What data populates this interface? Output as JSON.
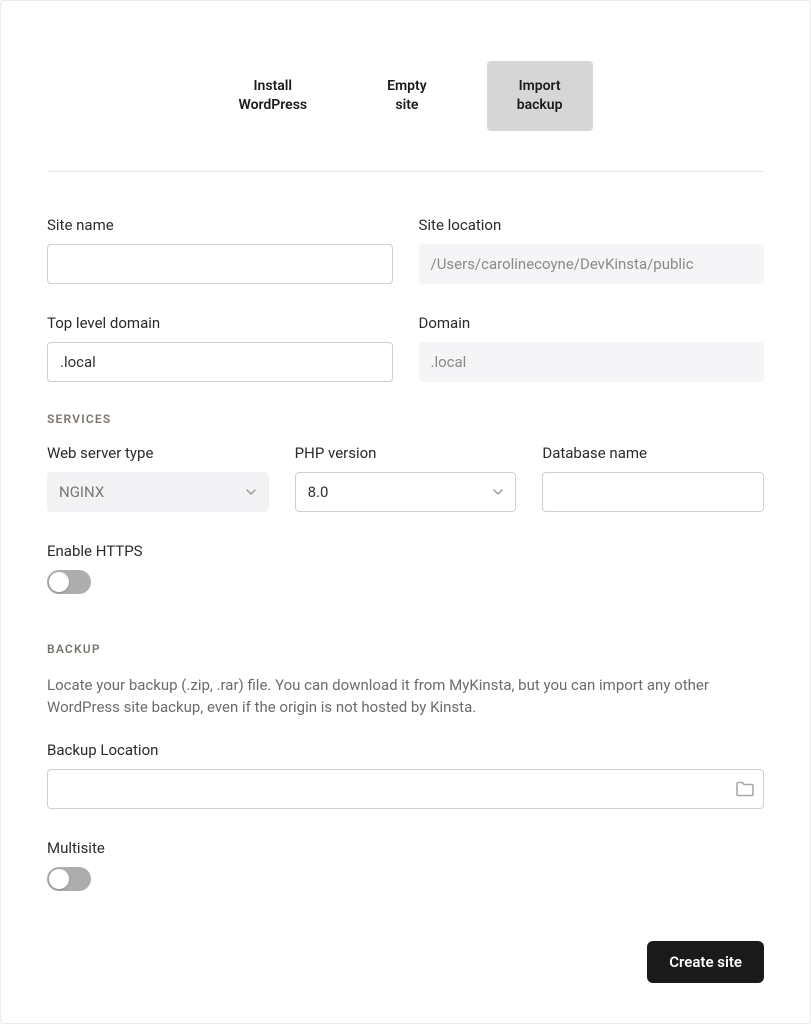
{
  "tabs": {
    "install": "Install\nWordPress",
    "empty": "Empty\nsite",
    "import": "Import\nbackup"
  },
  "fields": {
    "siteName": {
      "label": "Site name",
      "value": ""
    },
    "siteLocation": {
      "label": "Site location",
      "value": "/Users/carolinecoyne/DevKinsta/public"
    },
    "tld": {
      "label": "Top level domain",
      "value": ".local"
    },
    "domain": {
      "label": "Domain",
      "value": ".local"
    }
  },
  "sections": {
    "services": "SERVICES",
    "backup": "BACKUP"
  },
  "services": {
    "webServer": {
      "label": "Web server type",
      "value": "NGINX"
    },
    "php": {
      "label": "PHP version",
      "value": "8.0"
    },
    "dbName": {
      "label": "Database name",
      "value": ""
    },
    "https": {
      "label": "Enable HTTPS",
      "on": false
    }
  },
  "backup": {
    "help": "Locate your backup (.zip, .rar) file. You can download it from MyKinsta, but you can import any other WordPress site backup, even if the origin is not hosted by Kinsta.",
    "location": {
      "label": "Backup Location",
      "value": ""
    },
    "multisite": {
      "label": "Multisite",
      "on": false
    }
  },
  "footer": {
    "create": "Create site"
  }
}
